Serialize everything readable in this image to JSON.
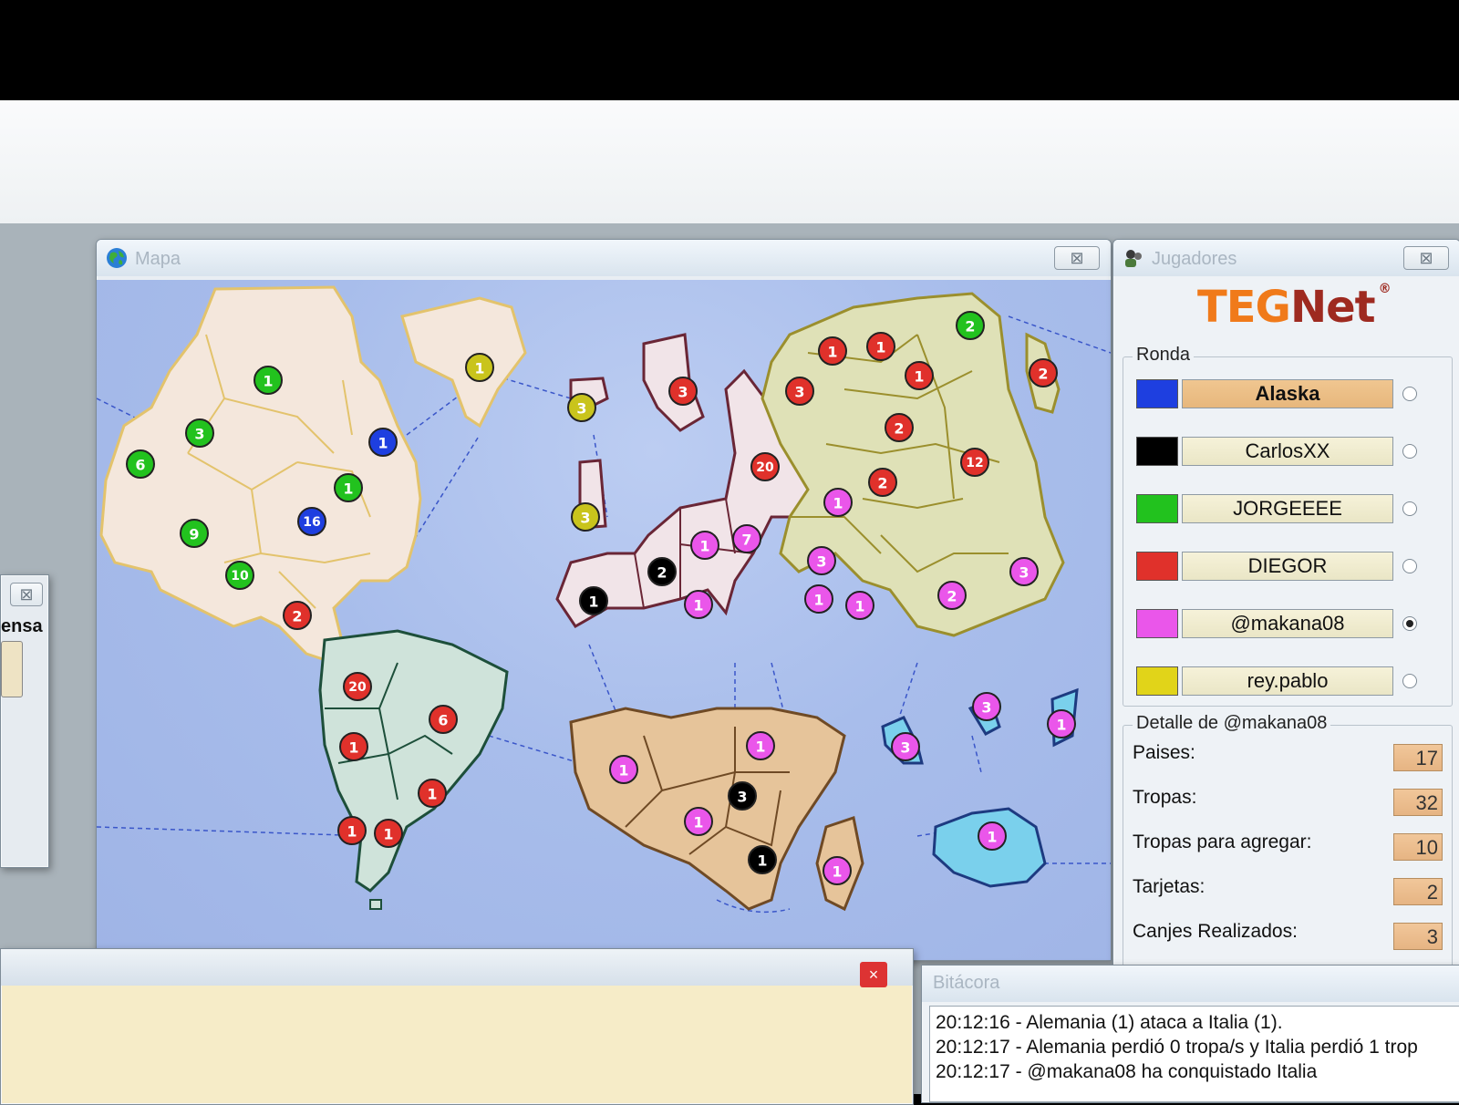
{
  "map_window": {
    "title": "Mapa",
    "close_icon": "close-icon"
  },
  "players_window": {
    "title": "Jugadores",
    "logo_teg": "TEG",
    "logo_net": "Net",
    "logo_reg": "®",
    "round_label": "Ronda",
    "players": [
      {
        "name": "Alaska",
        "color": "#1e3fe0",
        "active": true,
        "selected": false
      },
      {
        "name": "CarlosXX",
        "color": "#000000",
        "active": false,
        "selected": false
      },
      {
        "name": "JORGEEEE",
        "color": "#22c21e",
        "active": false,
        "selected": false
      },
      {
        "name": "DIEGOR",
        "color": "#e0312b",
        "active": false,
        "selected": false
      },
      {
        "name": "@makana08",
        "color": "#ea56ea",
        "active": false,
        "selected": true
      },
      {
        "name": "rey.pablo",
        "color": "#e1d419",
        "active": false,
        "selected": false
      }
    ],
    "detail_label": "Detalle de @makana08",
    "details": [
      {
        "label": "Paises:",
        "value": "17"
      },
      {
        "label": "Tropas:",
        "value": "32"
      },
      {
        "label": "Tropas para agregar:",
        "value": "10"
      },
      {
        "label": "Tarjetas:",
        "value": "2"
      },
      {
        "label": "Canjes Realizados:",
        "value": "3"
      }
    ]
  },
  "side_window": {
    "label": "ensa"
  },
  "log_window": {
    "title": "Bitácora",
    "lines": [
      "20:12:16 - Alemania (1) ataca a Italia (1).",
      "20:12:17 - Alemania perdió 0 tropa/s y Italia perdió 1 trop",
      "20:12:17 - @makana08 ha conquistado Italia"
    ]
  },
  "bottom_window": {
    "close_label": "×"
  },
  "colors": {
    "blue": "#1e3fe0",
    "black": "#000000",
    "green": "#22c21e",
    "red": "#e0312b",
    "pink": "#ea56ea",
    "yellow": "#c9c41c"
  },
  "army_badges": [
    {
      "owner": "green",
      "count": "1"
    },
    {
      "owner": "green",
      "count": "3"
    },
    {
      "owner": "green",
      "count": "6"
    },
    {
      "owner": "blue",
      "count": "1"
    },
    {
      "owner": "green",
      "count": "1"
    },
    {
      "owner": "blue",
      "count": "16"
    },
    {
      "owner": "green",
      "count": "9"
    },
    {
      "owner": "green",
      "count": "10"
    },
    {
      "owner": "red",
      "count": "2"
    },
    {
      "owner": "yellow",
      "count": "1"
    },
    {
      "owner": "yellow",
      "count": "3"
    },
    {
      "owner": "yellow",
      "count": "3"
    },
    {
      "owner": "red",
      "count": "20"
    },
    {
      "owner": "red",
      "count": "6"
    },
    {
      "owner": "red",
      "count": "1"
    },
    {
      "owner": "red",
      "count": "1"
    },
    {
      "owner": "red",
      "count": "1"
    },
    {
      "owner": "red",
      "count": "1"
    },
    {
      "owner": "red",
      "count": "3"
    },
    {
      "owner": "red",
      "count": "20"
    },
    {
      "owner": "black",
      "count": "2"
    },
    {
      "owner": "black",
      "count": "1"
    },
    {
      "owner": "pink",
      "count": "1"
    },
    {
      "owner": "pink",
      "count": "7"
    },
    {
      "owner": "pink",
      "count": "1"
    },
    {
      "owner": "red",
      "count": "1"
    },
    {
      "owner": "red",
      "count": "1"
    },
    {
      "owner": "green",
      "count": "2"
    },
    {
      "owner": "red",
      "count": "3"
    },
    {
      "owner": "red",
      "count": "1"
    },
    {
      "owner": "red",
      "count": "2"
    },
    {
      "owner": "red",
      "count": "2"
    },
    {
      "owner": "red",
      "count": "12"
    },
    {
      "owner": "red",
      "count": "2"
    },
    {
      "owner": "pink",
      "count": "1"
    },
    {
      "owner": "pink",
      "count": "3"
    },
    {
      "owner": "pink",
      "count": "1"
    },
    {
      "owner": "pink",
      "count": "1"
    },
    {
      "owner": "pink",
      "count": "2"
    },
    {
      "owner": "pink",
      "count": "3"
    },
    {
      "owner": "pink",
      "count": "1"
    },
    {
      "owner": "pink",
      "count": "1"
    },
    {
      "owner": "black",
      "count": "3"
    },
    {
      "owner": "pink",
      "count": "1"
    },
    {
      "owner": "black",
      "count": "1"
    },
    {
      "owner": "pink",
      "count": "1"
    },
    {
      "owner": "pink",
      "count": "3"
    },
    {
      "owner": "pink",
      "count": "3"
    },
    {
      "owner": "pink",
      "count": "1"
    },
    {
      "owner": "pink",
      "count": "1"
    }
  ]
}
